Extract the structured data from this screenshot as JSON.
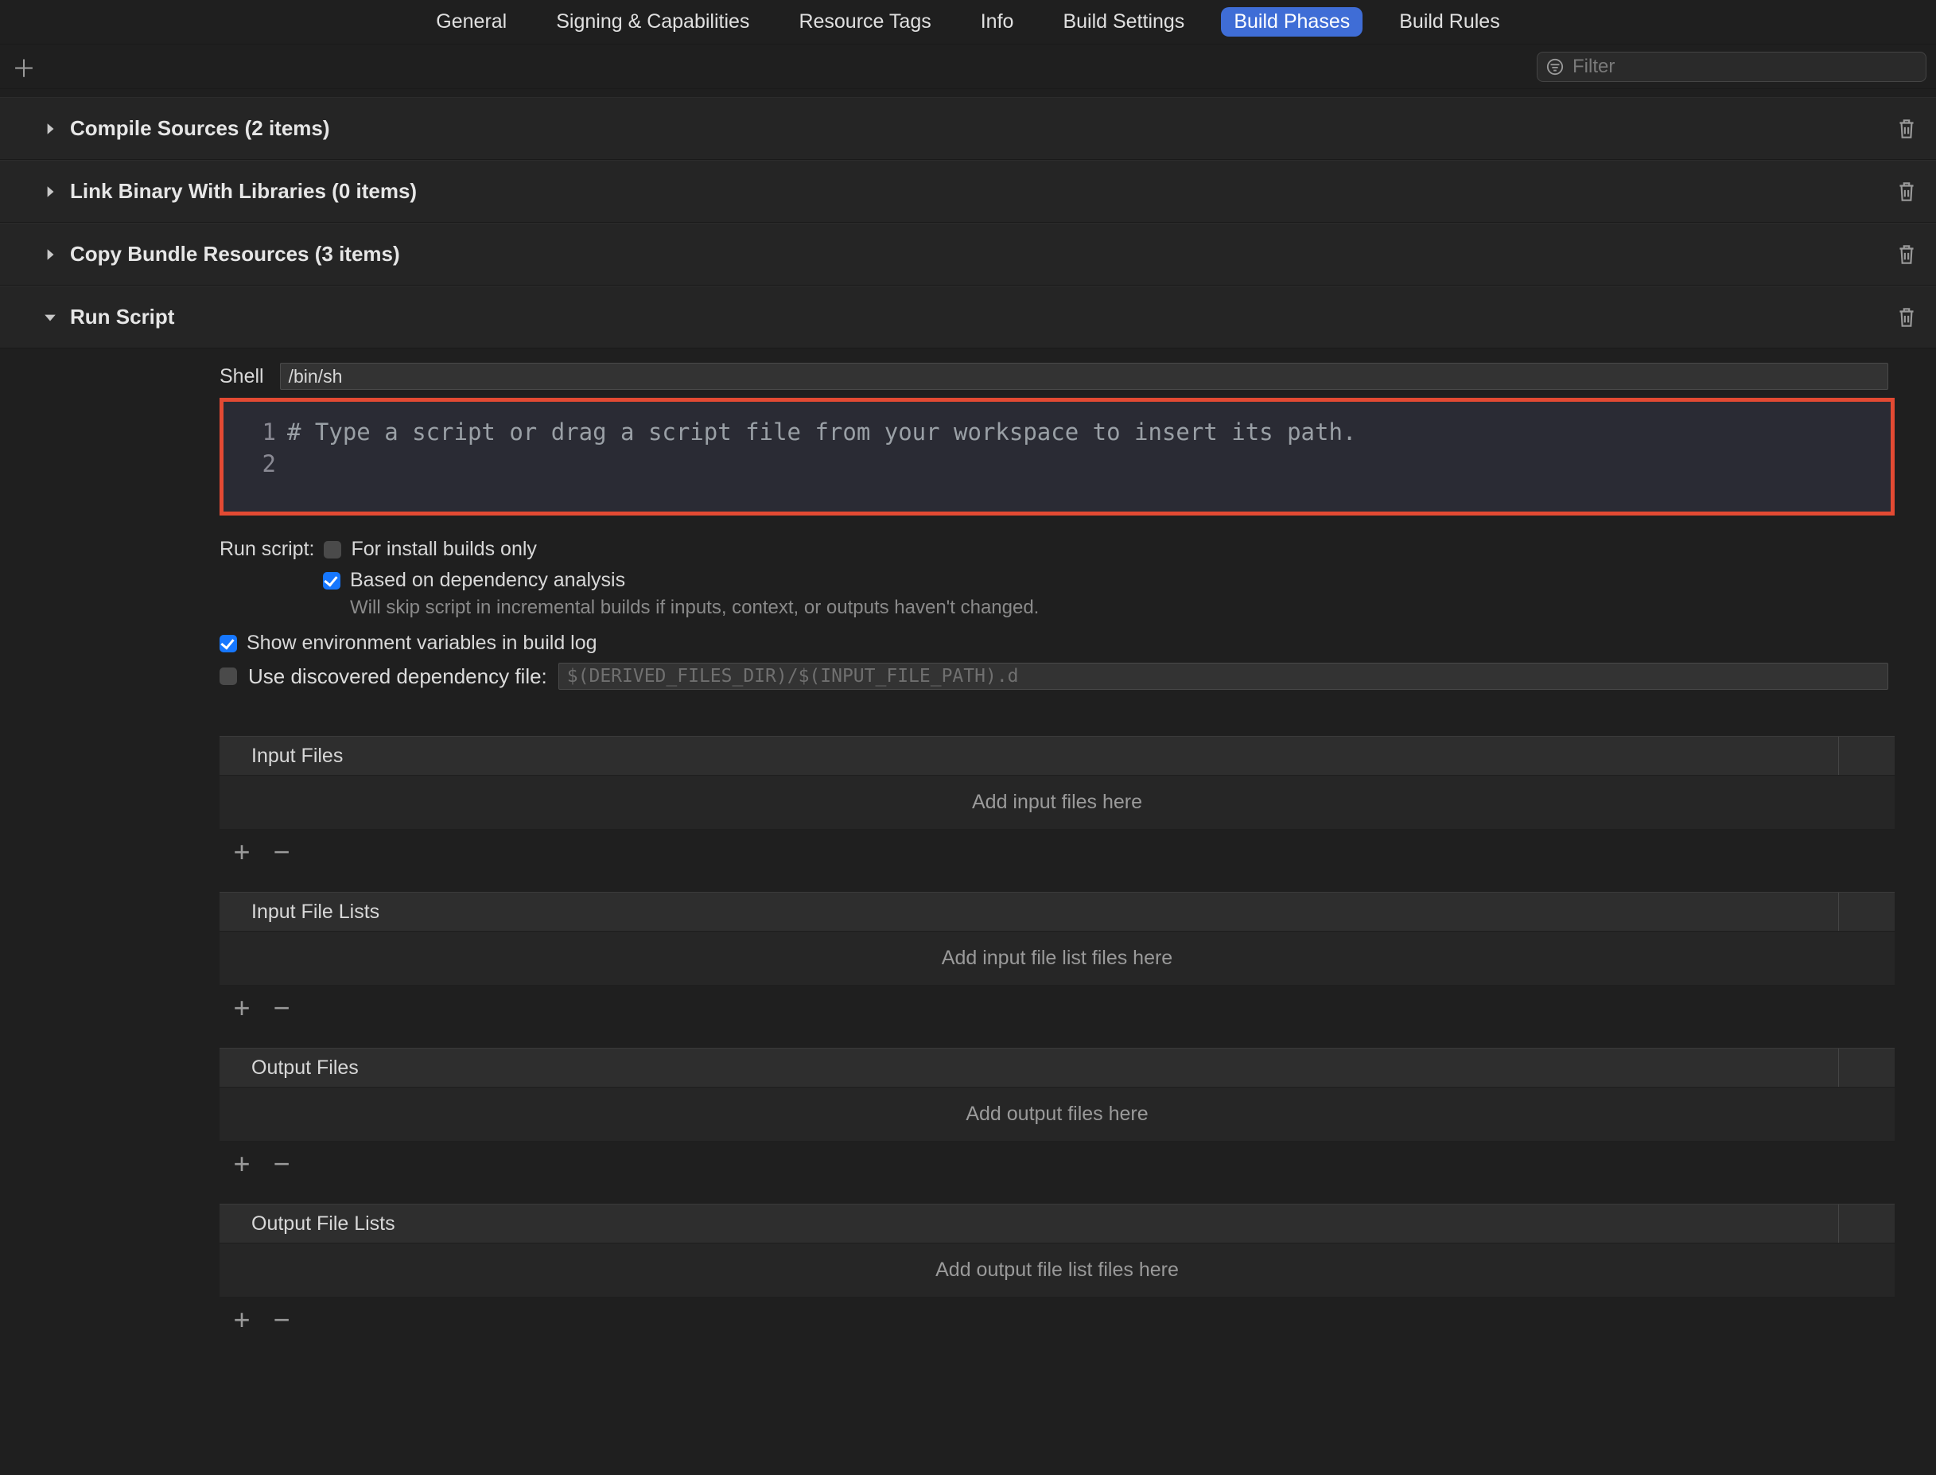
{
  "tabs": {
    "general": "General",
    "signing": "Signing & Capabilities",
    "resource_tags": "Resource Tags",
    "info": "Info",
    "build_settings": "Build Settings",
    "build_phases": "Build Phases",
    "build_rules": "Build Rules"
  },
  "toolbar": {
    "filter_placeholder": "Filter"
  },
  "phases": {
    "compile_sources": "Compile Sources (2 items)",
    "link_binary": "Link Binary With Libraries (0 items)",
    "copy_bundle": "Copy Bundle Resources (3 items)",
    "run_script": "Run Script"
  },
  "script": {
    "shell_label": "Shell",
    "shell_value": "/bin/sh",
    "line_1": "1",
    "line_2": "2",
    "comment": "# Type a script or drag a script file from your workspace to insert its path.",
    "run_script_label": "Run script:",
    "install_only": "For install builds only",
    "dependency_analysis": "Based on dependency analysis",
    "dependency_hint": "Will skip script in incremental builds if inputs, context, or outputs haven't changed.",
    "show_env": "Show environment variables in build log",
    "use_discovered": "Use discovered dependency file:",
    "dep_placeholder": "$(DERIVED_FILES_DIR)/$(INPUT_FILE_PATH).d"
  },
  "file_sections": {
    "input_files": {
      "title": "Input Files",
      "empty": "Add input files here"
    },
    "input_file_lists": {
      "title": "Input File Lists",
      "empty": "Add input file list files here"
    },
    "output_files": {
      "title": "Output Files",
      "empty": "Add output files here"
    },
    "output_file_lists": {
      "title": "Output File Lists",
      "empty": "Add output file list files here"
    }
  }
}
